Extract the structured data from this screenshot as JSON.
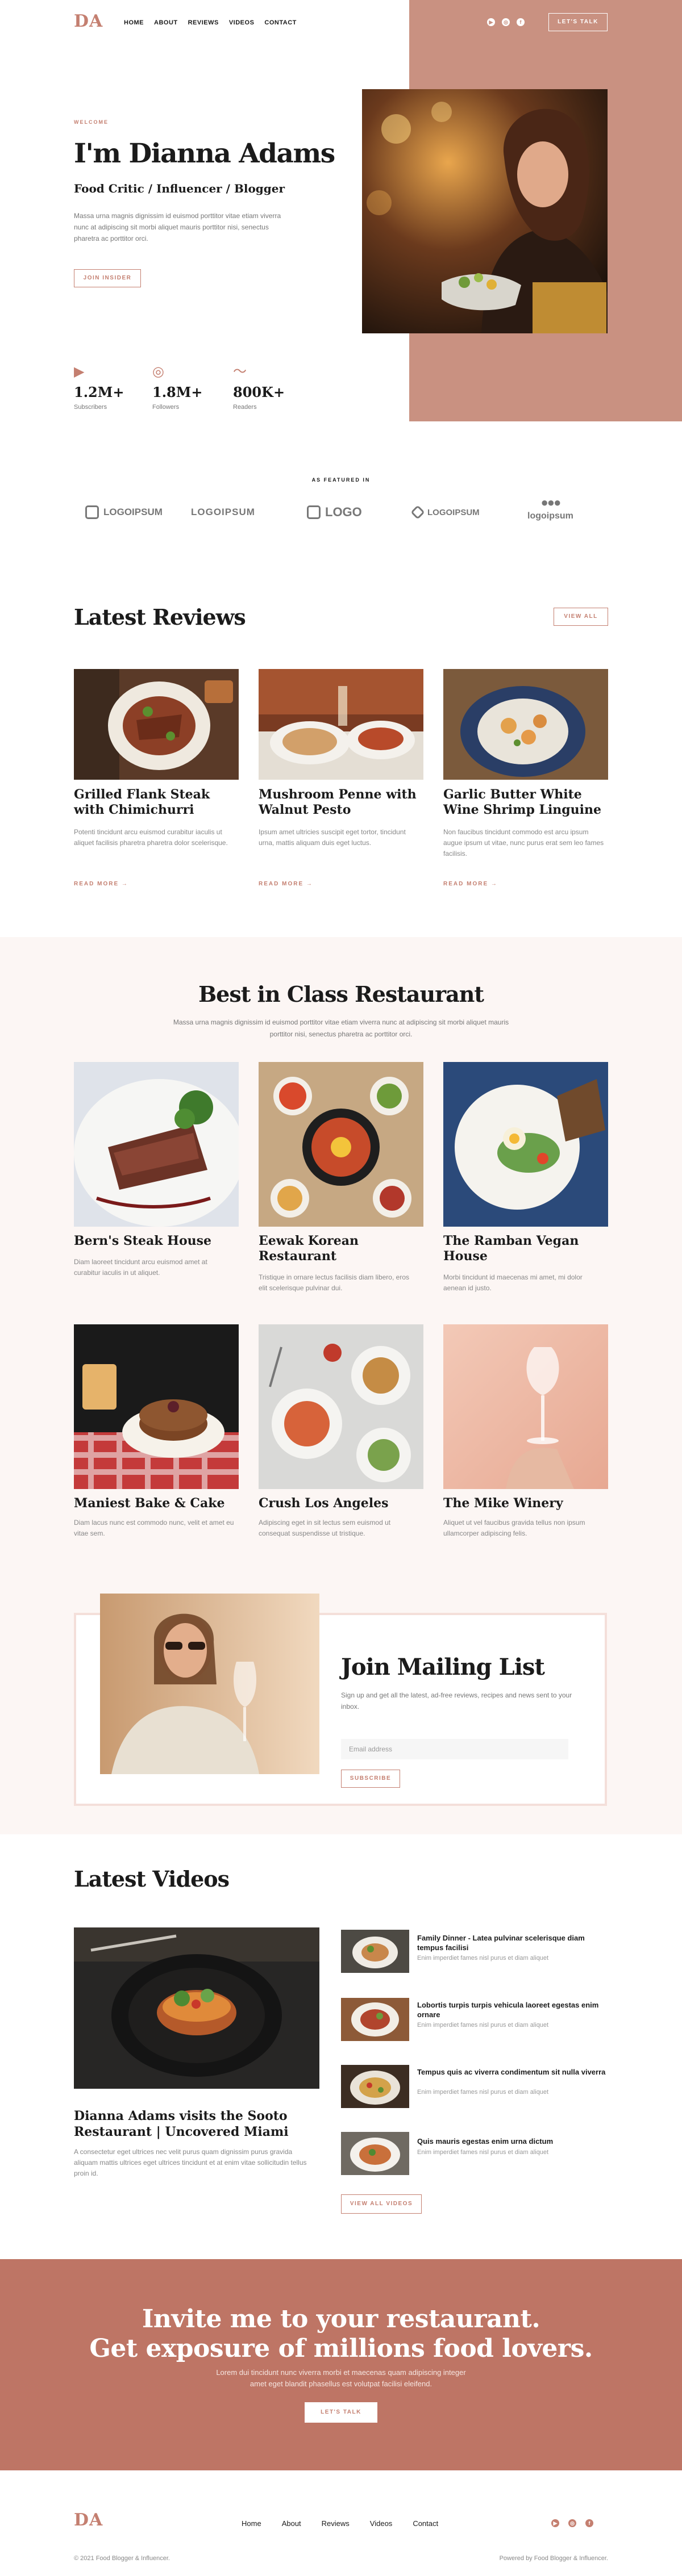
{
  "brand": {
    "logo": "DA",
    "accent": "#c47f70",
    "hero_bg": "#c99181",
    "cta_bg": "#be7565"
  },
  "nav": {
    "items": [
      "HOME",
      "ABOUT",
      "REVIEWS",
      "VIDEOS",
      "CONTACT"
    ],
    "cta": "LET'S TALK"
  },
  "hero": {
    "eyebrow": "WELCOME",
    "title": "I'm Dianna Adams",
    "subtitle": "Food Critic / Influencer / Blogger",
    "text": "Massa urna magnis dignissim id euismod porttitor vitae etiam viverra nunc at adipiscing sit morbi aliquet mauris porttitor nisi, senectus pharetra ac porttitor orci.",
    "button": "JOIN INSIDER"
  },
  "stats": [
    {
      "icon": "youtube-icon",
      "value": "1.2M+",
      "label": "Subscribers"
    },
    {
      "icon": "instagram-icon",
      "value": "1.8M+",
      "label": "Followers"
    },
    {
      "icon": "rss-icon",
      "value": "800K+",
      "label": "Readers"
    }
  ],
  "featured": {
    "label": "AS FEATURED IN",
    "logos": [
      "LOGOIPSUM",
      "LOGOIPSUM",
      "LOGO",
      "LOGOIPSUM",
      "logoipsum"
    ]
  },
  "reviews": {
    "title": "Latest Reviews",
    "view_all": "VIEW ALL",
    "read_more": "READ MORE",
    "items": [
      {
        "title": "Grilled Flank Steak with Chimichurri",
        "text": "Potenti tincidunt arcu euismod curabitur iaculis ut aliquet facilisis pharetra pharetra dolor scelerisque."
      },
      {
        "title": "Mushroom Penne with Walnut Pesto",
        "text": "Ipsum amet ultricies suscipit eget tortor, tincidunt urna, mattis aliquam duis eget luctus."
      },
      {
        "title": "Garlic Butter White Wine Shrimp Linguine",
        "text": "Non faucibus tincidunt commodo est arcu ipsum augue ipsum ut vitae, nunc purus erat sem leo fames facilisis."
      }
    ]
  },
  "restaurants": {
    "title": "Best in Class Restaurant",
    "text": "Massa urna magnis dignissim id euismod porttitor vitae etiam viverra nunc at adipiscing sit morbi aliquet mauris porttitor nisi, senectus pharetra ac porttitor orci.",
    "items": [
      {
        "title": "Bern's Steak House",
        "text": "Diam laoreet tincidunt arcu euismod amet at curabitur iaculis in ut aliquet."
      },
      {
        "title": "Eewak Korean Restaurant",
        "text": "Tristique in ornare lectus facilisis diam libero, eros elit scelerisque pulvinar dui."
      },
      {
        "title": "The Ramban Vegan House",
        "text": "Morbi tincidunt id maecenas mi amet, mi dolor aenean id justo."
      },
      {
        "title": "Maniest Bake & Cake",
        "text": "Diam lacus nunc est commodo nunc, velit et amet eu vitae sem."
      },
      {
        "title": "Crush Los Angeles",
        "text": "Adipiscing eget in sit lectus sem euismod ut consequat suspendisse ut tristique."
      },
      {
        "title": "The Mike Winery",
        "text": "Aliquet ut vel faucibus gravida tellus non ipsum ullamcorper adipiscing felis."
      }
    ]
  },
  "mailing": {
    "title": "Join Mailing List",
    "text": "Sign up and get all the latest, ad-free reviews, recipes and news sent to your inbox.",
    "placeholder": "Email address",
    "button": "SUBSCRIBE"
  },
  "videos": {
    "title": "Latest Videos",
    "main_title": "Dianna Adams visits the Sooto Restaurant | Uncovered Miami",
    "main_text": "A consectetur eget ultrices nec velit purus quam dignissim purus gravida aliquam mattis ultrices eget ultrices tincidunt et at enim vitae sollicitudin tellus proin id.",
    "view_all": "VIEW ALL VIDEOS",
    "items": [
      {
        "title": "Family Dinner - Latea pulvinar scelerisque diam tempus facilisi",
        "text": "Enim imperdiet fames nisl purus et diam aliquet"
      },
      {
        "title": "Lobortis turpis turpis vehicula laoreet egestas enim ornare",
        "text": "Enim imperdiet fames nisl purus et diam aliquet"
      },
      {
        "title": "Tempus quis ac viverra condimentum sit nulla viverra",
        "text": "Enim imperdiet fames nisl purus et diam aliquet"
      },
      {
        "title": "Quis mauris egestas enim urna dictum",
        "text": "Enim imperdiet fames nisl purus et diam aliquet"
      }
    ]
  },
  "cta": {
    "line1": "Invite me to your restaurant.",
    "line2": "Get exposure of millions food lovers.",
    "text1": "Lorem dui tincidunt nunc viverra morbi et maecenas quam adipiscing integer",
    "text2": "amet eget blandit phasellus est volutpat facilisi eleifend.",
    "button": "LET'S TALK"
  },
  "footer": {
    "logo": "DA",
    "nav": [
      "Home",
      "About",
      "Reviews",
      "Videos",
      "Contact"
    ],
    "copyright": "© 2021 Food Blogger & Influencer.",
    "powered": "Powered by Food Blogger & Influencer."
  }
}
